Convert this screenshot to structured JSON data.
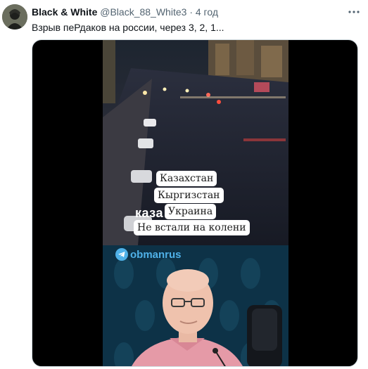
{
  "tweet": {
    "display_name": "Black & White",
    "handle": "@Black_88_White3",
    "separator": "·",
    "time": "4 год",
    "text": "Взрыв пеРдаков на россии, через 3, 2, 1..."
  },
  "video": {
    "captions": [
      "Казахстан",
      "Кыргизстан",
      "Украина",
      "Не встали на колени"
    ],
    "overlay_text": "каза      и на",
    "channel_tag": "obmanrus"
  },
  "icons": {
    "more": "more-horizontal-icon",
    "telegram": "telegram-icon"
  },
  "colors": {
    "text_primary": "#0f1419",
    "text_secondary": "#536471",
    "telegram_blue": "#4fb1e8"
  }
}
